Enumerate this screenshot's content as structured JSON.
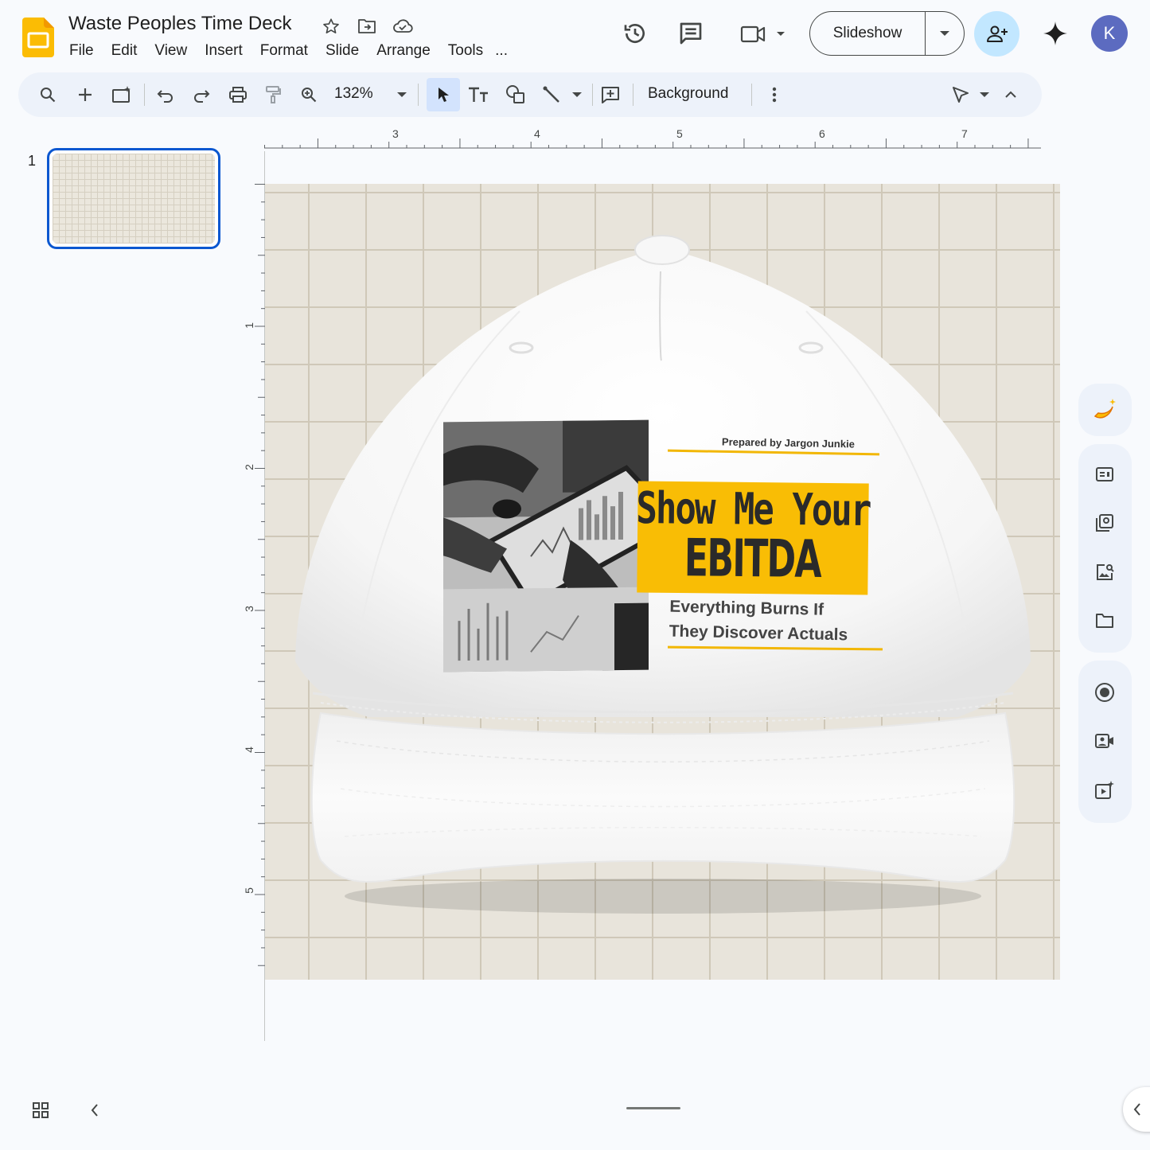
{
  "app": {
    "title": "Waste Peoples Time Deck",
    "account_initial": "K"
  },
  "menu": [
    "File",
    "Edit",
    "View",
    "Insert",
    "Format",
    "Slide",
    "Arrange",
    "Tools"
  ],
  "menu_more": "...",
  "header": {
    "slideshow_label": "Slideshow"
  },
  "toolbar": {
    "zoom": "132%",
    "background_label": "Background"
  },
  "filmstrip": {
    "slides": [
      {
        "number": "1"
      }
    ]
  },
  "ruler": {
    "horizontal": [
      "3",
      "4",
      "5",
      "6",
      "7"
    ],
    "vertical": [
      "1",
      "2",
      "3",
      "4",
      "5"
    ]
  },
  "slide": {
    "prepared_by": "Prepared by Jargon Junkie",
    "headline_line1": "Show Me Your",
    "headline_line2": "EBITDA",
    "tagline_line1": "Everything Burns If",
    "tagline_line2": "They Discover Actuals"
  },
  "colors": {
    "accent_blue": "#0b57d0",
    "banner_yellow": "#f9bd05",
    "share_bg": "#c2e7ff",
    "slides_logo": "#fbbc04"
  }
}
